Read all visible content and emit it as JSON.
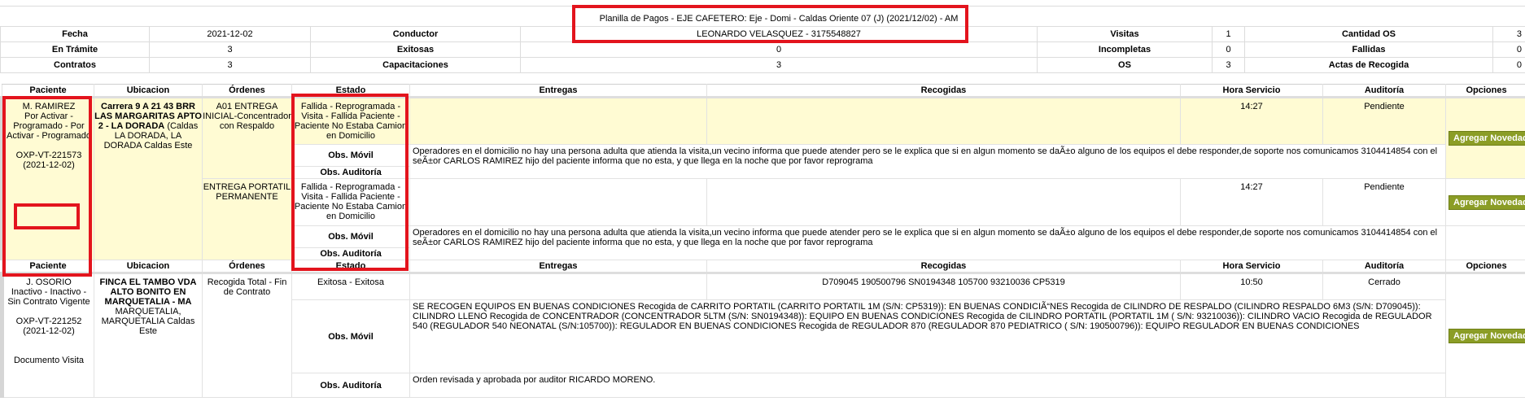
{
  "header": {
    "title": "Planilla de Pagos - EJE CAFETERO: Eje - Domi - Caldas Oriente 07 (J) (2021/12/02) - AM",
    "driver": "LEONARDO VELASQUEZ - 3175548827"
  },
  "summary": {
    "fecha_label": "Fecha",
    "fecha_value": "2021-12-02",
    "conductor_label": "Conductor",
    "visitas_label": "Visitas",
    "visitas_value": "1",
    "cantidad_os_label": "Cantidad OS",
    "cantidad_os_value": "3",
    "en_tramite_label": "En Trámite",
    "en_tramite_value": "3",
    "exitosas_label": "Exitosas",
    "exitosas_value": "0",
    "incompletas_label": "Incompletas",
    "incompletas_value": "0",
    "fallidas_label": "Fallidas",
    "fallidas_value": "0",
    "contratos_label": "Contratos",
    "contratos_value": "3",
    "capacitaciones_label": "Capacitaciones",
    "capacitaciones_value": "3",
    "os_label": "OS",
    "os_value": "3",
    "actas_label": "Actas de Recogida",
    "actas_value": "0"
  },
  "columns": {
    "paciente": "Paciente",
    "ubicacion": "Ubicacion",
    "ordenes": "Órdenes",
    "estado": "Estado",
    "entregas": "Entregas",
    "recogidas": "Recogidas",
    "hora": "Hora Servicio",
    "auditoria": "Auditoría",
    "opciones": "Opciones"
  },
  "labels": {
    "obs_movil": "Obs. Móvil",
    "obs_auditoria": "Obs. Auditoría",
    "agregar_novedad": "Agregar Novedad"
  },
  "patients": [
    {
      "name": "M. RAMIREZ",
      "status": "Por Activar - Programado - Por Activar - Programado",
      "id": "OXP-VT-221573",
      "date": "(2021-12-02)",
      "location_bold": "Carrera 9 A 21 43 BRR LAS MARGARITAS APTO 2 - LA DORADA",
      "location_rest": "(Caldas LA DORADA, LA DORADA Caldas Este",
      "orders": [
        {
          "order": "A01 ENTREGA INICIAL-Concentrador con Respaldo",
          "estado": "Fallida - Reprogramada - Visita - Fallida Paciente - Paciente No Estaba Camion en Domicilio",
          "entregas": "",
          "recogidas": "",
          "hora": "14:27",
          "auditoria": "Pendiente",
          "obs_movil": "Operadores en el domicilio no hay una persona adulta que atienda la visita,un vecino informa que puede atender pero se le explica que si en algun momento se daÃ±o alguno de los equipos el debe responder,de soporte nos comunicamos 3104414854 con el seÃ±or CARLOS RAMIREZ hijo del paciente informa que no esta, y que llega en la noche que por favor reprograma",
          "obs_auditoria": ""
        },
        {
          "order": "ENTREGA PORTATIL PERMANENTE",
          "estado": "Fallida - Reprogramada - Visita - Fallida Paciente - Paciente No Estaba Camion en Domicilio",
          "entregas": "",
          "recogidas": "",
          "hora": "14:27",
          "auditoria": "Pendiente",
          "obs_movil": "Operadores en el domicilio no hay una persona adulta que atienda la visita,un vecino informa que puede atender pero se le explica que si en algun momento se daÃ±o alguno de los equipos el debe responder,de soporte nos comunicamos 3104414854 con el seÃ±or CARLOS RAMIREZ hijo del paciente informa que no esta, y que llega en la noche que por favor reprograma",
          "obs_auditoria": ""
        }
      ]
    },
    {
      "name": "J. OSORIO",
      "status": "Inactivo - Inactivo - Sin Contrato Vigente",
      "id": "OXP-VT-221252",
      "date": "(2021-12-02)",
      "doc_link": "Documento Visita",
      "location_bold": "FINCA EL TAMBO VDA ALTO BONITO EN MARQUETALIA - MA",
      "location_rest": "MARQUETALIA, MARQUETALIA Caldas Este",
      "orders": [
        {
          "order": "Recogida Total - Fin de Contrato",
          "estado": "Exitosa - Exitosa",
          "entregas": "",
          "recogidas": "D709045 190500796 SN0194348 105700 93210036 CP5319",
          "hora": "10:50",
          "auditoria": "Cerrado",
          "obs_movil": "SE RECOGEN EQUIPOS EN BUENAS CONDICIONES Recogida de CARRITO PORTATIL (CARRITO PORTATIL 1M (S/N: CP5319)): EN BUENAS CONDICIÃ“NES Recogida de CILINDRO DE RESPALDO (CILINDRO RESPALDO 6M3 (S/N: D709045)): CILINDRO LLENO Recogida de CONCENTRADOR (CONCENTRADOR 5LTM (S/N: SN0194348)): EQUIPO EN BUENAS CONDICIONES Recogida de CILINDRO PORTATIL (PORTATIL 1M ( S/N: 93210036)): CILINDRO VACIO Recogida de REGULADOR 540 (REGULADOR 540 NEONATAL (S/N:105700)): REGULADOR EN BUENAS CONDICIONES Recogida de REGULADOR 870 (REGULADOR 870 PEDIATRICO ( S/N: 190500796)): EQUIPO REGULADOR EN BUENAS CONDICIONES",
          "obs_auditoria": "Orden revisada y aprobada por auditor RICARDO MORENO."
        }
      ]
    }
  ]
}
